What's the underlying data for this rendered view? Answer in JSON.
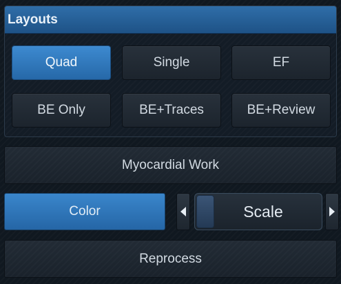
{
  "layouts": {
    "title": "Layouts",
    "buttons": [
      {
        "label": "Quad",
        "active": true
      },
      {
        "label": "Single",
        "active": false
      },
      {
        "label": "EF",
        "active": false
      },
      {
        "label": "BE Only",
        "active": false
      },
      {
        "label": "BE+Traces",
        "active": false
      },
      {
        "label": "BE+Review",
        "active": false
      }
    ]
  },
  "myocardial_work": {
    "label": "Myocardial Work"
  },
  "color": {
    "label": "Color",
    "active": true
  },
  "scale": {
    "label": "Scale",
    "left_icon": "triangle-left-icon",
    "right_icon": "triangle-right-icon"
  },
  "reprocess": {
    "label": "Reprocess"
  },
  "colors": {
    "accent": "#2f78bd",
    "header": "#2a639c",
    "panel_bg": "#131c26",
    "button_bg": "#222b35",
    "text": "#d2dae2"
  }
}
